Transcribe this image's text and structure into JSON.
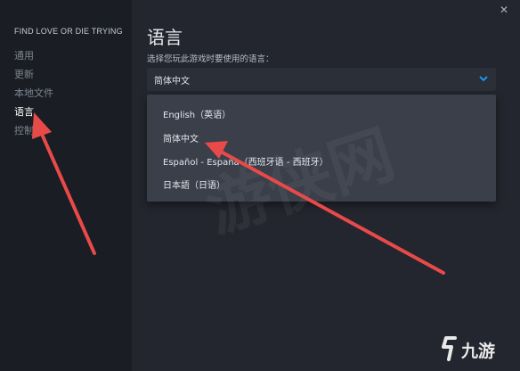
{
  "sidebar": {
    "game_title": "FIND LOVE OR DIE TRYING",
    "items": [
      {
        "label": "通用"
      },
      {
        "label": "更新"
      },
      {
        "label": "本地文件"
      },
      {
        "label": "语言"
      },
      {
        "label": "控制器"
      }
    ],
    "active_index": 3
  },
  "main": {
    "title": "语言",
    "field_label": "选择您玩此游戏时要使用的语言：",
    "selected_language": "简体中文",
    "options": [
      {
        "label": "English（英语）"
      },
      {
        "label": "简体中文"
      },
      {
        "label": "Español - España（西班牙语 - 西班牙）"
      },
      {
        "label": "日本語（日语）"
      }
    ]
  },
  "window": {
    "close_symbol": "✕"
  },
  "branding": {
    "logo_text": "九游",
    "watermark_text": "游侠网"
  },
  "colors": {
    "arrow": "#e84a4a",
    "accent": "#1a9fff"
  },
  "icons": {
    "chevron": "chevron-down-icon",
    "close": "close-icon",
    "logo": "jiuyou-logo-icon"
  }
}
